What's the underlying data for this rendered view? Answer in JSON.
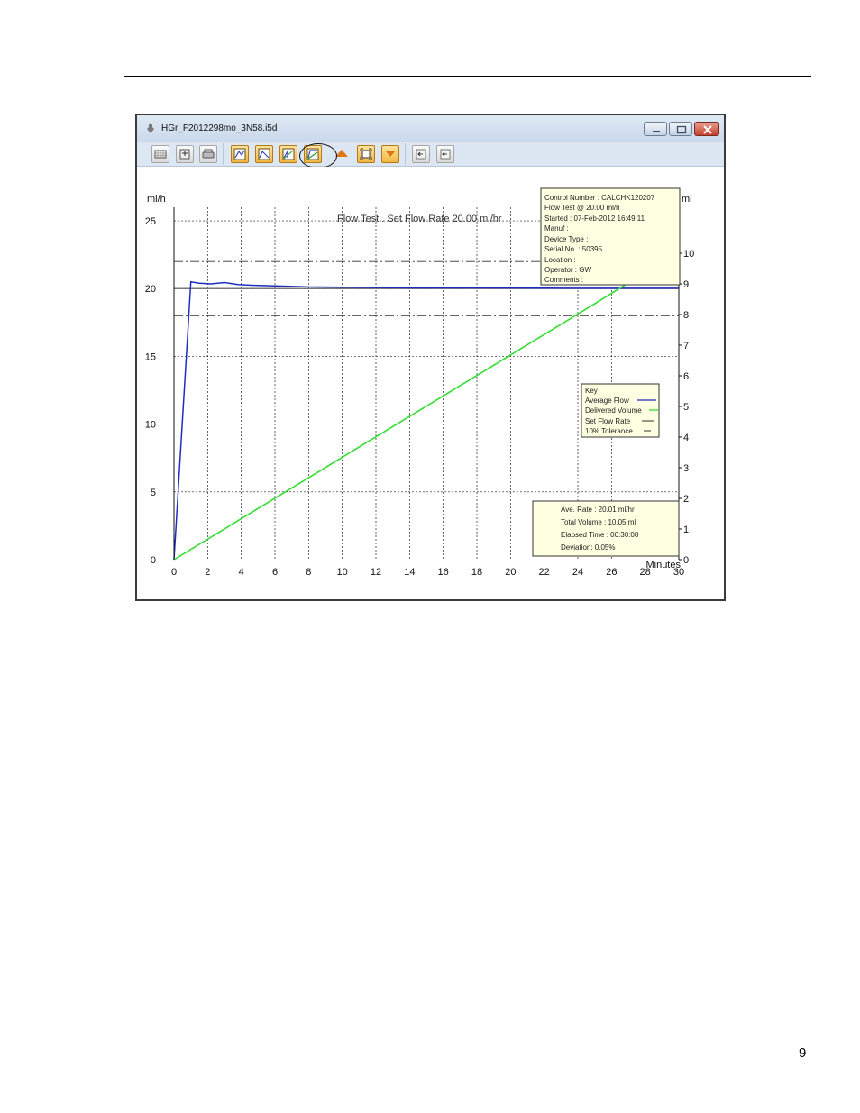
{
  "page_number": "9",
  "window": {
    "title": "HGr_F2012298mo_3N58.i5d",
    "title_icon": "app-icon",
    "controls": [
      "minimize-icon",
      "maximize-icon",
      "close-icon"
    ]
  },
  "toolbar": {
    "tools": [
      {
        "name": "grid-view",
        "icon": "grid-icon"
      },
      {
        "name": "export",
        "icon": "export-icon"
      },
      {
        "name": "print",
        "icon": "printer-icon"
      },
      {
        "name": "chart-flow",
        "icon": "chart-icon",
        "active": true
      },
      {
        "name": "chart-trumpet",
        "icon": "chart-icon",
        "active": true
      },
      {
        "name": "chart-volume",
        "icon": "chart-icon",
        "active": true
      },
      {
        "name": "chart-both",
        "icon": "chart-icon",
        "active": true,
        "highlighted": true
      },
      {
        "name": "zoom-up",
        "icon": "triangle-up-icon",
        "active": true
      },
      {
        "name": "zoom-fit",
        "icon": "fit-icon",
        "active": true
      },
      {
        "name": "zoom-down",
        "icon": "triangle-down-icon",
        "active": true
      },
      {
        "name": "previous",
        "icon": "arrow-left-icon"
      },
      {
        "name": "next",
        "icon": "arrow-left-icon"
      }
    ]
  },
  "info_box": {
    "lines": [
      "Control Number   :  CALCHK120207",
      "Flow Test @ 20.00 ml/h",
      "Started : 07-Feb-2012  16:49:11",
      "Manuf :",
      "Device Type :",
      "Serial No.  :  50395",
      "Location :",
      "Operator : GW",
      "Comments :"
    ]
  },
  "key_box": {
    "title": "Key",
    "entries": [
      {
        "label": "Average Flow",
        "color": "#1f2dbf",
        "style": "solid"
      },
      {
        "label": "Delivered Volume",
        "color": "#33dd33",
        "style": "solid"
      },
      {
        "label": "Set Flow Rate",
        "color": "#555555",
        "style": "solid"
      },
      {
        "label": "10% Tolerance",
        "color": "#333333",
        "style": "dashdot"
      }
    ]
  },
  "summary_box": {
    "lines": [
      "Ave. Rate : 20.01 ml/hr",
      "Total Volume : 10.05 ml",
      "Elapsed Time : 00:30:08",
      "Deviation:  0.05%"
    ]
  },
  "chart_data": {
    "type": "line",
    "title": "Flow Test . Set Flow Rate 20.00 ml/hr",
    "xlabel": "Minutes",
    "ylabel": "ml/h",
    "y2label": "ml",
    "xlim": [
      0,
      30
    ],
    "ylim": [
      0,
      26
    ],
    "y2lim": [
      0,
      11.5
    ],
    "xticks": [
      0,
      2,
      4,
      6,
      8,
      10,
      12,
      14,
      16,
      18,
      20,
      22,
      24,
      26,
      28,
      30
    ],
    "yticks": [
      0,
      5,
      10,
      15,
      20,
      25
    ],
    "y2ticks": [
      0,
      1,
      2,
      3,
      4,
      5,
      6,
      7,
      8,
      9,
      10
    ],
    "grid": true,
    "legend": "right",
    "set_flow_rate": 20,
    "tolerance": [
      18,
      22
    ],
    "series": [
      {
        "name": "Average Flow",
        "axis": "left",
        "color": "#1f2dbf",
        "x": [
          0,
          1,
          1.5,
          2.2,
          3,
          3.8,
          4.6,
          6,
          8,
          10,
          14,
          18,
          22,
          26,
          30
        ],
        "y": [
          0,
          20.5,
          20.4,
          20.35,
          20.45,
          20.3,
          20.25,
          20.2,
          20.12,
          20.1,
          20.05,
          20.05,
          20.03,
          20.02,
          20.02
        ]
      },
      {
        "name": "Delivered Volume",
        "axis": "right",
        "color": "#33dd33",
        "x": [
          0,
          5,
          10,
          15,
          20,
          25,
          30
        ],
        "y": [
          0,
          1.67,
          3.34,
          5.01,
          6.68,
          8.35,
          10.05
        ]
      }
    ]
  }
}
